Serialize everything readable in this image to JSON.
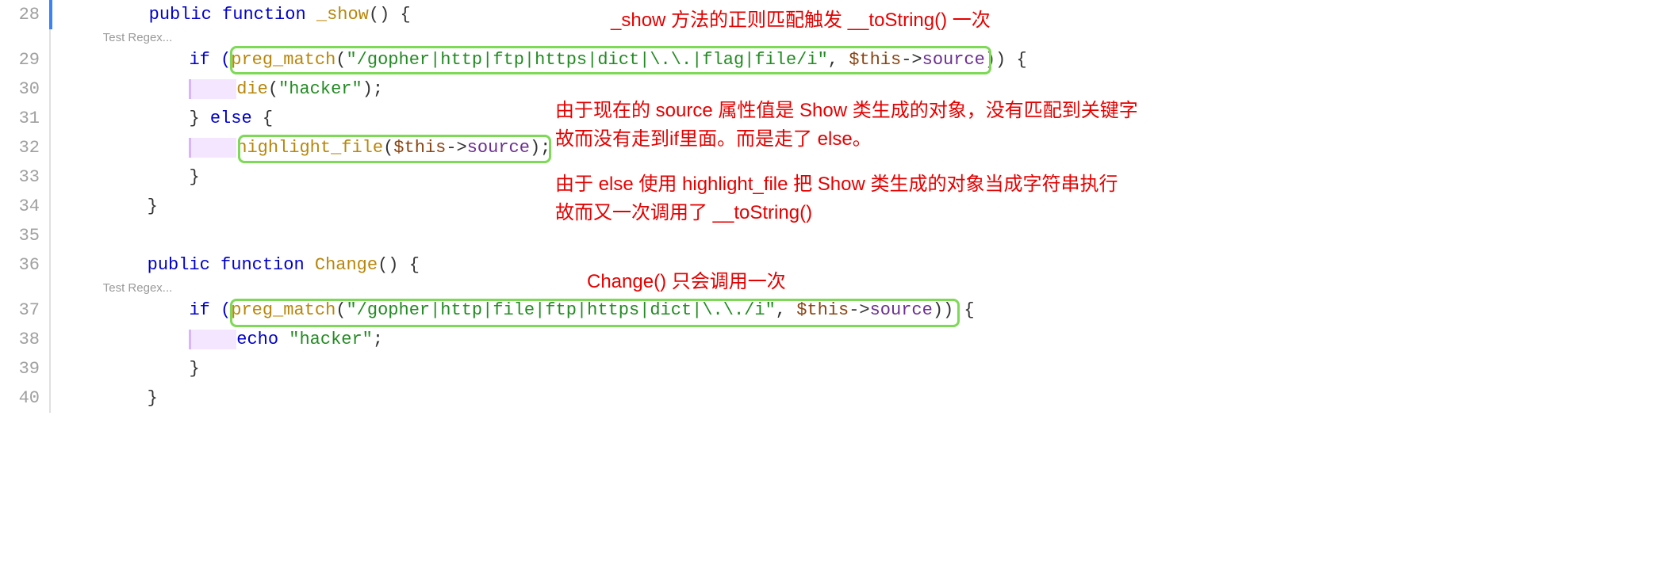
{
  "codelens": "Test Regex...",
  "lines": {
    "28": {
      "num": "28",
      "tokens": [
        "public",
        " ",
        "function",
        " ",
        "_show",
        "() {"
      ]
    },
    "29": {
      "num": "29",
      "pre": "if (",
      "fn": "preg_match",
      "open": "(",
      "str": "\"/gopher|http|ftp|https|dict|\\.\\.|flag|file/i\"",
      "comma": ", ",
      "var": "$this",
      "arrow": "->",
      "prop": "source",
      "close_a": ")",
      "close_b": ") {"
    },
    "30": {
      "num": "30",
      "fn": "die",
      "open": "(",
      "str": "\"hacker\"",
      "close": ");"
    },
    "31": {
      "num": "31",
      "tokens": [
        "} ",
        "else",
        " {"
      ]
    },
    "32": {
      "num": "32",
      "fn": "highlight_file",
      "open": "(",
      "var": "$this",
      "arrow": "->",
      "prop": "source",
      "close": ");"
    },
    "33": {
      "num": "33",
      "text": "}"
    },
    "34": {
      "num": "34",
      "text": "}"
    },
    "35": {
      "num": "35",
      "text": ""
    },
    "36": {
      "num": "36",
      "tokens": [
        "public",
        " ",
        "function",
        " ",
        "Change",
        "() {"
      ]
    },
    "37": {
      "num": "37",
      "pre": "if (",
      "fn": "preg_match",
      "open": "(",
      "str": "\"/gopher|http|file|ftp|https|dict|\\.\\./i\"",
      "comma": ", ",
      "var": "$this",
      "arrow": "->",
      "prop": "source",
      "close_a": ")",
      "close_b": ") {"
    },
    "38": {
      "num": "38",
      "pre": "echo ",
      "str": "\"hacker\"",
      "end": ";"
    },
    "39": {
      "num": "39",
      "text": "}"
    },
    "40": {
      "num": "40",
      "text": "}"
    }
  },
  "annotations": {
    "a1": "_show 方法的正则匹配触发 __toString() 一次",
    "a2_l1": "由于现在的 source 属性值是 Show 类生成的对象，没有匹配到关键字",
    "a2_l2": "故而没有走到if里面。而是走了 else。",
    "a3_l1": "由于 else 使用 highlight_file 把 Show 类生成的对象当成字符串执行",
    "a3_l2": "故而又一次调用了 __toString()",
    "a4": "Change() 只会调用一次"
  }
}
